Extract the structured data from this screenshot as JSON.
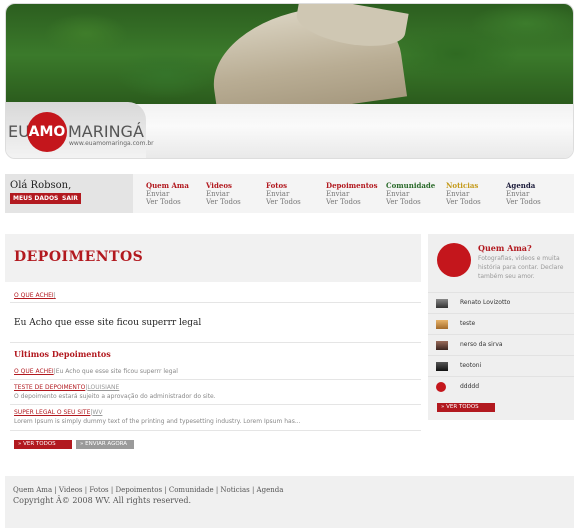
{
  "logo": {
    "part1": "EU",
    "part2": "AMO",
    "part3": "MARINGÁ",
    "url": "www.euamomaringa.com.br"
  },
  "user": {
    "greeting": "Olá Robson,",
    "my_data": "MEUS DADOS",
    "logout": "SAIR"
  },
  "nav": [
    {
      "title": "Quem Ama",
      "sub1": "Enviar",
      "sub2": "Ver Todos",
      "color": "#b2191f"
    },
    {
      "title": "Videos",
      "sub1": "Enviar",
      "sub2": "Ver Todos",
      "color": "#b2191f"
    },
    {
      "title": "Fotos",
      "sub1": "Enviar",
      "sub2": "Ver Todos",
      "color": "#b2191f"
    },
    {
      "title": "Depoimentos",
      "sub1": "Enviar",
      "sub2": "Ver Todos",
      "color": "#b2191f"
    },
    {
      "title": "Comunidade",
      "sub1": "Enviar",
      "sub2": "Ver Todos",
      "color": "#2b6b2b"
    },
    {
      "title": "Noticias",
      "sub1": "Enviar",
      "sub2": "Ver Todos",
      "color": "#c49a1a"
    },
    {
      "title": "Agenda",
      "sub1": "Enviar",
      "sub2": "Ver Todos",
      "color": "#1b1b3a"
    }
  ],
  "main": {
    "title": "DEPOIMENTOS",
    "featured_author_link": "O QUE ACHEI",
    "featured_author_sep": "|",
    "featured_text": "Eu Acho que esse site ficou superrr legal",
    "section_title": "Ultimos Depoimentos",
    "items": [
      {
        "title": "O QUE ACHEI",
        "sep": "|",
        "text": "Eu Acho que esse site ficou superrr legal",
        "author": "",
        "sub": ""
      },
      {
        "title": "TESTE DE DEPOIMENTO",
        "sep": "|",
        "text": "",
        "author": "LOUISIANE",
        "sub": "O depoimento estará sujeito a aprovação do administrador do site."
      },
      {
        "title": "SUPER LEGAL O SEU SITE",
        "sep": "|",
        "text": "",
        "author": "WV",
        "sub": "Lorem Ipsum is simply dummy text of the printing and typesetting industry. Lorem Ipsum has..."
      }
    ],
    "see_all": "» VER TODOS",
    "send_now": "» ENVIAR AGORA"
  },
  "sidebar": {
    "title": "Quem Ama?",
    "text": "Fotografias, videos e muita história para contar. Declare também seu amor.",
    "people": [
      {
        "name": "Renato Lovizotto",
        "icon": "photo-icon"
      },
      {
        "name": "teste",
        "icon": "photo-icon"
      },
      {
        "name": "nerso da sirva",
        "icon": "photo-icon"
      },
      {
        "name": "teotoni",
        "icon": "photo-icon"
      },
      {
        "name": "ddddd",
        "icon": "heart-icon"
      }
    ],
    "see_all": "» VER TODOS"
  },
  "footer": {
    "links": "Quem Ama | Videos | Fotos | Depoimentos | Comunidade | Noticias | Agenda",
    "copyright": "Copyright Â© 2008 WV. All rights reserved."
  },
  "colors": {
    "accent": "#b2191f",
    "panel": "#efefef"
  }
}
